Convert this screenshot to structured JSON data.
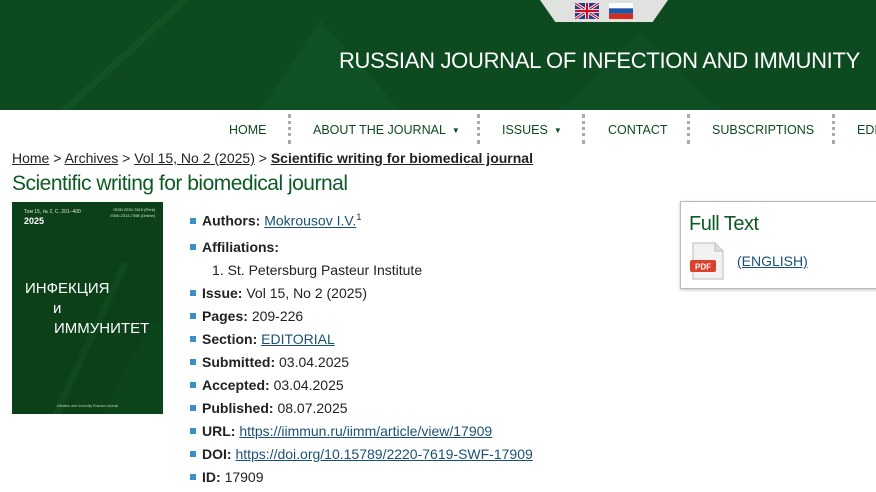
{
  "header": {
    "title": "RUSSIAN JOURNAL OF INFECTION AND IMMUNITY"
  },
  "nav": [
    {
      "label": "HOME"
    },
    {
      "label": "ABOUT THE JOURNAL"
    },
    {
      "label": "ISSUES"
    },
    {
      "label": "CONTACT"
    },
    {
      "label": "SUBSCRIPTIONS"
    },
    {
      "label": "EDI"
    }
  ],
  "breadcrumb": {
    "home": "Home",
    "archives": "Archives",
    "issue": "Vol 15, No 2 (2025)",
    "current": "Scientific writing for biomedical journal",
    "sep": ">"
  },
  "page_title": "Scientific writing for biomedical journal",
  "cover": {
    "line1": "Том 15, № 2, С. 201–400",
    "line2": "ISSN 2220-7619 (Print) ISSN 2313-7398 (Online)",
    "year": "2025",
    "t1": "ИНФЕКЦИЯ",
    "t2": "и",
    "t3": "ИММУНИТЕТ",
    "bottom": "Infection and Immunity Russian Journal"
  },
  "meta": {
    "authors": {
      "key": "Authors:",
      "value": "Mokrousov I.V.",
      "sup": "1"
    },
    "affiliations": {
      "key": "Affiliations:",
      "item": "1. St. Petersburg Pasteur Institute"
    },
    "issue": {
      "key": "Issue:",
      "value": "Vol 15, No 2 (2025)"
    },
    "pages": {
      "key": "Pages:",
      "value": "209-226"
    },
    "section": {
      "key": "Section:",
      "value": "EDITORIAL"
    },
    "submitted": {
      "key": "Submitted:",
      "value": "03.04.2025"
    },
    "accepted": {
      "key": "Accepted:",
      "value": "03.04.2025"
    },
    "published": {
      "key": "Published:",
      "value": "08.07.2025"
    },
    "url": {
      "key": "URL:",
      "value": "https://iimmun.ru/iimm/article/view/17909"
    },
    "doi": {
      "key": "DOI:",
      "value": "https://doi.org/10.15789/2220-7619-SWF-17909"
    },
    "id": {
      "key": "ID:",
      "value": "17909"
    }
  },
  "fulltext": {
    "title": "Full Text",
    "link": "(ENGLISH)",
    "pdf_label": "PDF"
  },
  "colors": {
    "header_bg": "#0d4a1f",
    "title_green": "#0d5a24",
    "link_blue": "#1a5276",
    "bullet": "#3a8fc4"
  }
}
